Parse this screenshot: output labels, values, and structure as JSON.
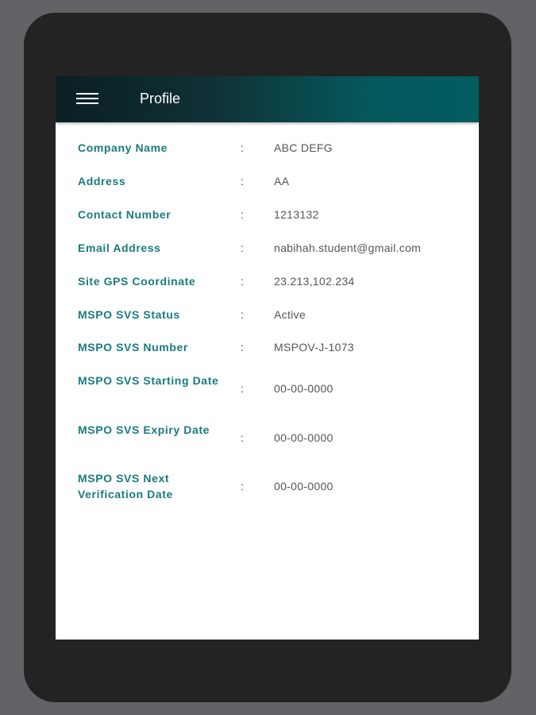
{
  "app_bar": {
    "title": "Profile",
    "menu_icon": "hamburger-menu-icon",
    "gradient_colors": [
      "#0a1f24",
      "#035c60"
    ]
  },
  "colors": {
    "label": "#1a7a7f",
    "value": "#555555",
    "background": "#ffffff"
  },
  "profile": {
    "rows": [
      {
        "label": "Company Name",
        "value": "ABC DEFG"
      },
      {
        "label": "Address",
        "value": "AA"
      },
      {
        "label": "Contact Number",
        "value": "1213132"
      },
      {
        "label": "Email Address",
        "value": "nabihah.student@gmail.com"
      },
      {
        "label": "Site GPS Coordinate",
        "value": "23.213,102.234"
      },
      {
        "label": "MSPO SVS Status",
        "value": "Active"
      },
      {
        "label": "MSPO SVS Number",
        "value": "MSPOV-J-1073"
      },
      {
        "label": "MSPO SVS Starting Date",
        "value": "00-00-0000"
      },
      {
        "label": "MSPO SVS Expiry Date",
        "value": "00-00-0000"
      },
      {
        "label": "MSPO SVS Next Verification Date",
        "value": "00-00-0000"
      }
    ],
    "separator": ":"
  }
}
